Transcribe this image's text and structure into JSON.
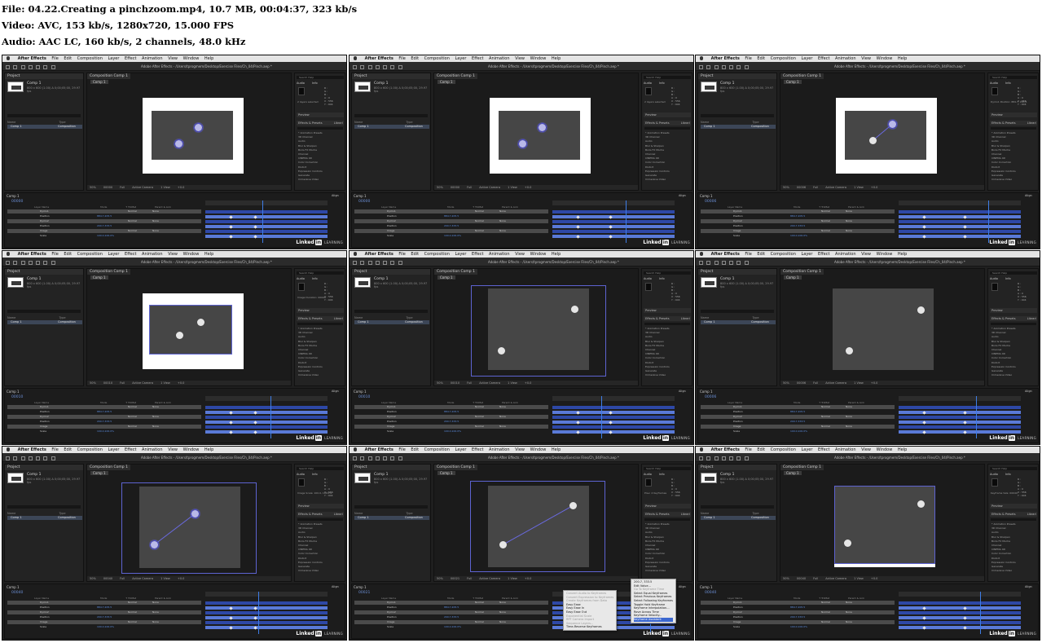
{
  "header": {
    "file": "File: 04.22.Creating a pinchzoom.mp4, 10.7 MB, 00:04:37, 323 kb/s",
    "video": "Video: AVC, 153 kb/s, 1280x720, 15.000 FPS",
    "audio": "Audio: AAC LC, 160 kb/s, 2 channels, 48.0 kHz"
  },
  "app": {
    "menu": [
      "After Effects",
      "File",
      "Edit",
      "Composition",
      "Layer",
      "Effect",
      "Animation",
      "View",
      "Window",
      "Help"
    ],
    "window_title": "Adobe After Effects - /Users/tprogmem/Desktop/Exercise Files/Ch_04/Pinch.aep *"
  },
  "project": {
    "tab": "Project",
    "comp_name": "Comp 1",
    "comp_info": "800 x 600 (1.00) Δ 0;00;05;00, 29.97 fps",
    "column_name": "Name",
    "column_type": "Type",
    "item_name": "Comp 1",
    "item_type": "Composition"
  },
  "viewer": {
    "tab": "Composition Comp 1",
    "comp_tab": "Comp 1",
    "footer": [
      "50%",
      "0;00;00;00",
      "Full",
      "Active Camera",
      "1 View",
      "+0.0"
    ]
  },
  "right_panel": {
    "search": "Search Help",
    "tabs": [
      "Audio",
      "Info"
    ],
    "values": [
      "R : ",
      "G : ",
      "B : ",
      "A : 0",
      "X : 556",
      "Y : 404"
    ],
    "info_text": "2 layers selected",
    "preview": "Preview",
    "effects": "Effects & Presets",
    "libraries": "Librari",
    "effect_list": [
      "* Animation Presets",
      "3D Channel",
      "Audio",
      "Blur & Sharpen",
      "Boris FX Mocha",
      "Channel",
      "CINEMA 4D",
      "Color Correction",
      "Distort",
      "Expression Controls",
      "Generate",
      "Immersive Video"
    ]
  },
  "timeline": {
    "tab": "Comp 1",
    "time": "0;00;00;00",
    "align_tab": "Align",
    "columns": [
      "Layer Name",
      "Mode",
      "T TrkMat",
      "Parent & Link"
    ],
    "layers": [
      {
        "name": "Dymo1",
        "value": "",
        "mode": "Normal",
        "parent": "None"
      },
      {
        "name": "Position",
        "value": "884.7,205.5",
        "mode": "",
        "parent": ""
      },
      {
        "name": "Dymo2",
        "value": "",
        "mode": "Normal",
        "parent": "None"
      },
      {
        "name": "Position",
        "value": "200.7,333.5",
        "mode": "",
        "parent": ""
      },
      {
        "name": "Image",
        "value": "",
        "mode": "Normal",
        "parent": "None"
      },
      {
        "name": "Scale",
        "value": "100.0,100.0%",
        "mode": "",
        "parent": ""
      }
    ]
  },
  "watermark": {
    "brand": "Linked",
    "in": "in",
    "suffix": "LEARNING"
  },
  "context_menu_left": {
    "items": [
      {
        "label": "Convert Audio to Keyframes",
        "disabled": true
      },
      {
        "label": "Convert Expression to Keyframes",
        "disabled": true
      },
      {
        "label": "Create Keyframes from Data",
        "disabled": true
      },
      {
        "label": "Easy Ease",
        "disabled": false
      },
      {
        "label": "Easy Ease In",
        "disabled": false
      },
      {
        "label": "Easy Ease Out",
        "disabled": false
      },
      {
        "label": "Exponential Scale",
        "disabled": true
      },
      {
        "label": "RPF Camera Import",
        "disabled": true
      },
      {
        "label": "Sequence Layers...",
        "disabled": true
      },
      {
        "label": "Time-Reverse Keyframes",
        "disabled": false
      }
    ]
  },
  "context_menu_right": {
    "items": [
      {
        "label": "200.7, 333.5",
        "disabled": false
      },
      {
        "label": "Edit Value...",
        "disabled": false
      },
      {
        "label": "Go To Keyframe Time",
        "disabled": true
      },
      {
        "label": "Select Equal Keyframes",
        "disabled": false
      },
      {
        "label": "Select Previous Keyframes",
        "disabled": false
      },
      {
        "label": "Select Following Keyframes",
        "disabled": false
      },
      {
        "label": "Toggle Hold Keyframe",
        "disabled": false
      },
      {
        "label": "Keyframe Interpolation...",
        "disabled": false
      },
      {
        "label": "Rove Across Time",
        "disabled": false
      },
      {
        "label": "Keyframe Velocity...",
        "disabled": false
      },
      {
        "label": "Keyframe Assistant",
        "disabled": false
      }
    ]
  },
  "thumbnails": [
    {
      "time": "00000",
      "info": "2 layers selected"
    },
    {
      "time": "00000",
      "info": "2 layers selected"
    },
    {
      "time": "00006",
      "info": "Dymo1 Position: 884.7, 205.5"
    },
    {
      "time": "00010",
      "info": "Image Duration: 00000"
    },
    {
      "time": "00010",
      "info": ""
    },
    {
      "time": "00006",
      "info": ""
    },
    {
      "time": "00040",
      "info": "Image Scale: 100.0, 100.0%"
    },
    {
      "time": "00021",
      "info": "Prev: 2 Keyframes"
    },
    {
      "time": "00040",
      "info": "Keyframe Vals: 00040"
    }
  ]
}
